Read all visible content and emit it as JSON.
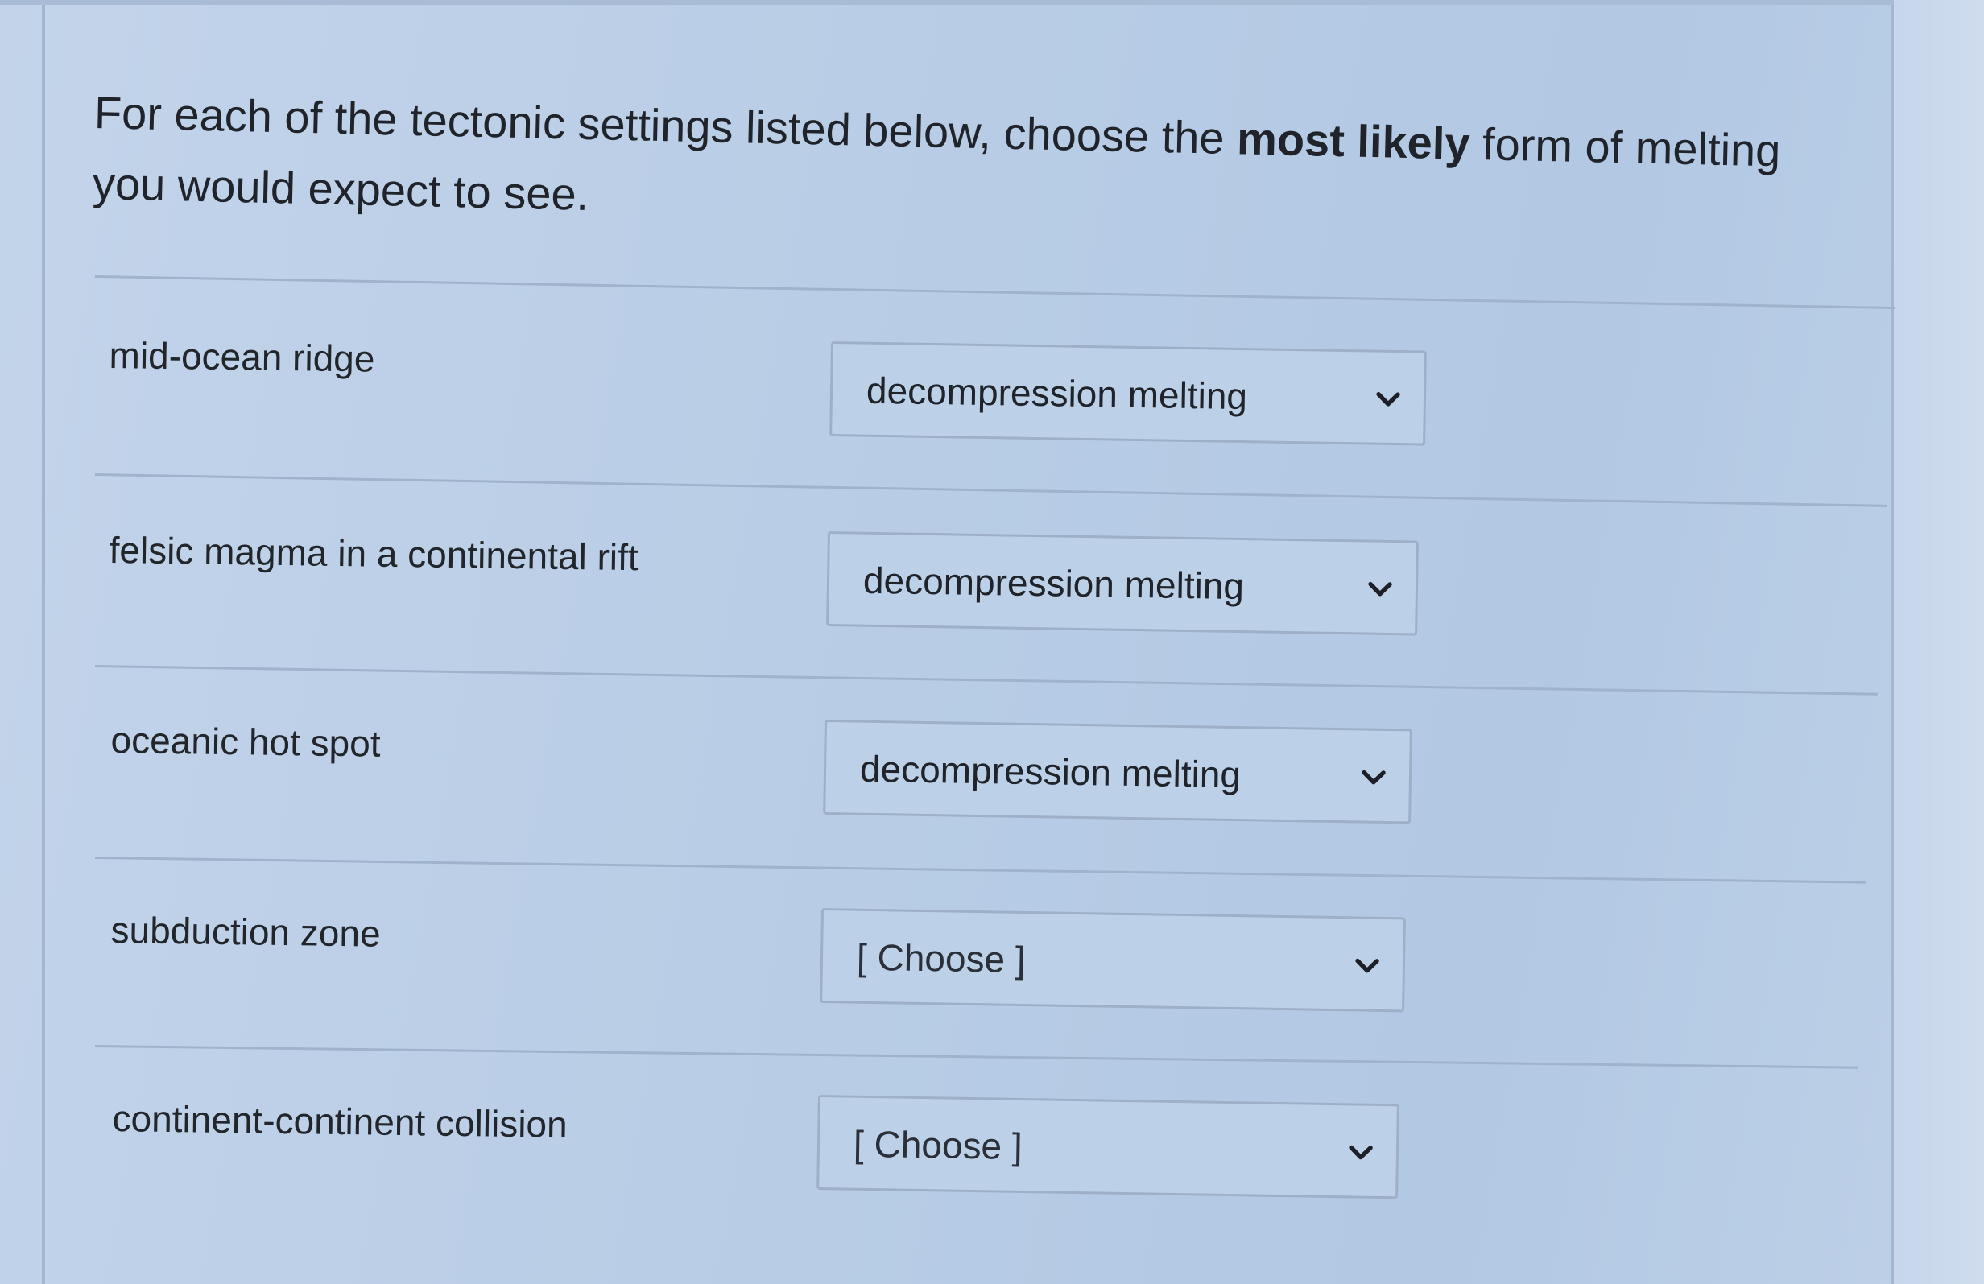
{
  "question": {
    "text_before": "For each of the tectonic settings listed below, choose the ",
    "emphasis": "most likely",
    "text_after": " form of melting you would expect to see."
  },
  "rows": [
    {
      "label": "mid-ocean ridge",
      "selected": "decompression melting"
    },
    {
      "label": "felsic magma in a continental rift",
      "selected": "decompression melting"
    },
    {
      "label": "oceanic hot spot",
      "selected": "decompression melting"
    },
    {
      "label": "subduction zone",
      "selected": "[ Choose ]"
    },
    {
      "label": "continent-continent collision",
      "selected": "[ Choose ]"
    }
  ],
  "icons": {
    "dropdown": "chevron-down-icon"
  },
  "colors": {
    "background": "#b9cde6",
    "text": "#22262b",
    "border": "#9db0c8"
  }
}
